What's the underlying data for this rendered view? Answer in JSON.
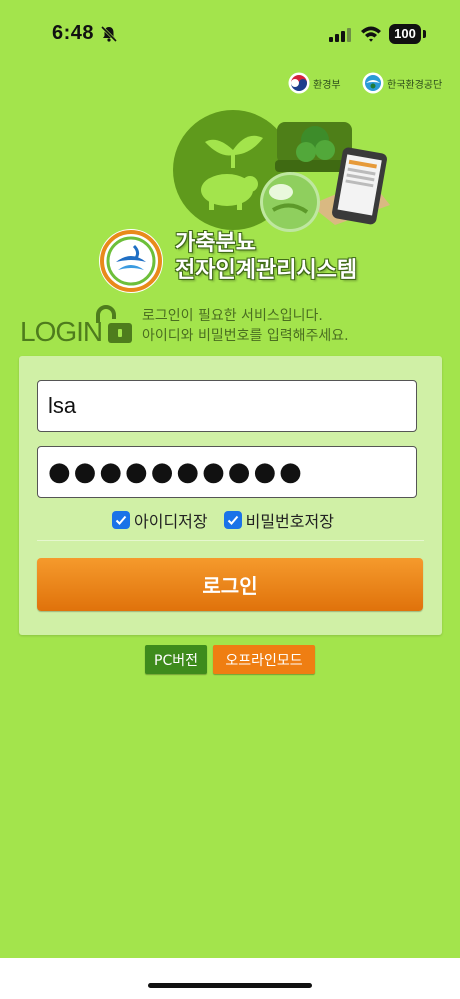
{
  "status_bar": {
    "time": "6:48",
    "battery": "100",
    "icons": [
      "bell-slash-icon",
      "cellular-signal-icon",
      "wifi-icon",
      "battery-icon"
    ]
  },
  "orgs": [
    {
      "label": "환경부",
      "icon": "taegeuk-emblem-icon"
    },
    {
      "label": "한국환경공단",
      "icon": "keco-emblem-icon"
    }
  ],
  "app": {
    "title_line1": "가축분뇨",
    "title_line2": "전자인계관리시스템"
  },
  "login_intro": {
    "login_word": "LOGIN",
    "line1": "로그인이 필요한 서비스입니다.",
    "line2": "아이디와 비밀번호를 입력해주세요."
  },
  "form": {
    "id_value": "lsa",
    "password_value": "●●●●●●●●●●",
    "remember_id_label": "아이디저장",
    "remember_id_checked": true,
    "remember_pw_label": "비밀번호저장",
    "remember_pw_checked": true,
    "login_button": "로그인"
  },
  "footer_buttons": {
    "pc_version": "PC버전",
    "offline_mode": "오프라인모드"
  },
  "colors": {
    "background": "#a3e44c",
    "panel": "#d0f0a6",
    "login_button": "#ef7e12",
    "pc_button": "#3e8b1c",
    "checkbox": "#1a73e8"
  }
}
